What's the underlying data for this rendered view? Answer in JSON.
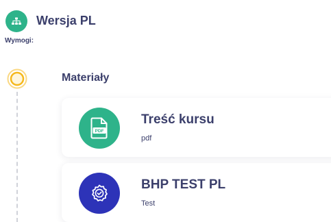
{
  "course": {
    "title": "Wersja PL",
    "icon": "sitemap-icon",
    "requirements_label": "Wymogi:"
  },
  "timeline": {
    "node_color": "#f5b81c",
    "line_color": "#d0d2d9"
  },
  "section": {
    "title": "Materiały",
    "items": [
      {
        "title": "Treść kursu",
        "subtitle": "pdf",
        "icon": "pdf-file-icon",
        "icon_color": "#2eb38a",
        "icon_text": "PDF"
      },
      {
        "title": "BHP TEST PL",
        "subtitle": "Test",
        "icon": "badge-check-icon",
        "icon_color": "#2d33b8"
      }
    ]
  },
  "colors": {
    "text": "#3b3f6b",
    "green": "#2eb38a",
    "blue": "#2d33b8",
    "yellow": "#f5b81c"
  }
}
